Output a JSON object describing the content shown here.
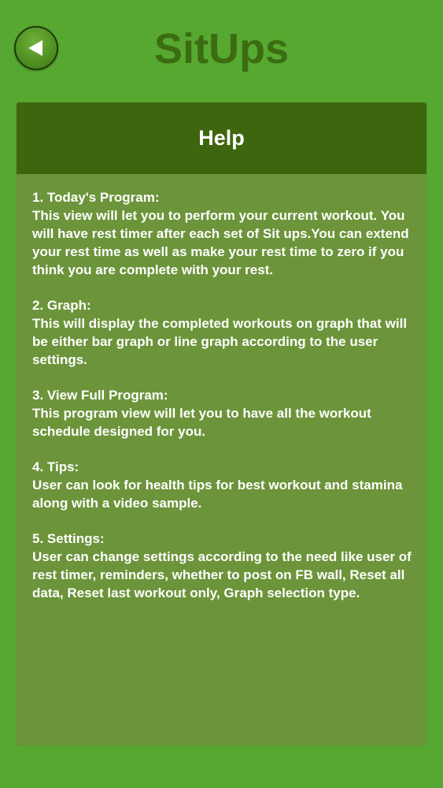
{
  "header": {
    "title": "SitUps",
    "back_icon": "back-arrow-icon"
  },
  "panel": {
    "title": "Help",
    "sections": [
      {
        "heading": "1. Today's Program:",
        "body": "This view will let you to perform your current workout. You will have rest timer after each set of Sit ups.You can extend your rest time as well as make your rest time to zero if you think you are complete with your rest."
      },
      {
        "heading": "2. Graph:",
        "body": "This will display the completed workouts on graph that will be either bar graph or line graph according to the user settings."
      },
      {
        "heading": "3. View Full Program:",
        "body": "This program view will let you to have all the workout schedule designed for you."
      },
      {
        "heading": "4. Tips:",
        "body": "User can look for health tips for best workout and stamina along with a video sample."
      },
      {
        "heading": "5. Settings:",
        "body": "User can change settings according to the need like user of rest timer, reminders, whether to post on FB wall, Reset all data, Reset last workout only, Graph selection type."
      }
    ]
  },
  "colors": {
    "background": "#57a830",
    "title": "#3b6c12",
    "panel": "#6c943a",
    "panel_header": "#3e660e",
    "text": "#ffffff"
  }
}
